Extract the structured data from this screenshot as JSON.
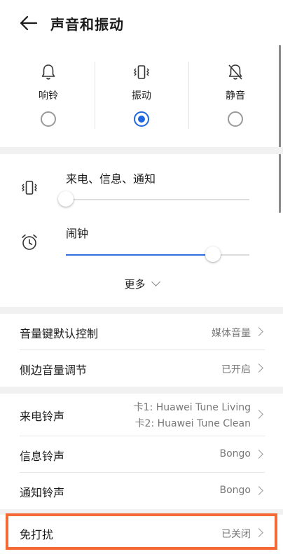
{
  "header": {
    "title": "声音和振动",
    "back_icon": "arrow-left-icon"
  },
  "modes": [
    {
      "label": "响铃",
      "icon": "bell-icon",
      "selected": false
    },
    {
      "label": "振动",
      "icon": "vibrate-icon",
      "selected": true
    },
    {
      "label": "静音",
      "icon": "bell-off-icon",
      "selected": false
    }
  ],
  "volume": {
    "ringtone": {
      "label": "来电、信息、通知",
      "icon": "vibrate-icon",
      "level": 0.0
    },
    "alarm": {
      "label": "闹钟",
      "icon": "alarm-clock-icon",
      "level": 0.8
    },
    "more_label": "更多"
  },
  "settings_group1": [
    {
      "label": "音量键默认控制",
      "value": "媒体音量"
    },
    {
      "label": "侧边音量调节",
      "value": "已开启"
    }
  ],
  "settings_group2": [
    {
      "label": "来电铃声",
      "value_line1": "卡1: Huawei Tune Living",
      "value_line2": "卡2: Huawei Tune Clean"
    },
    {
      "label": "信息铃声",
      "value": "Bongo"
    },
    {
      "label": "通知铃声",
      "value": "Bongo"
    }
  ],
  "dnd": {
    "label": "免打扰",
    "value": "已关闭"
  },
  "colors": {
    "accent": "#1f67e0",
    "highlight": "#f46a35"
  }
}
